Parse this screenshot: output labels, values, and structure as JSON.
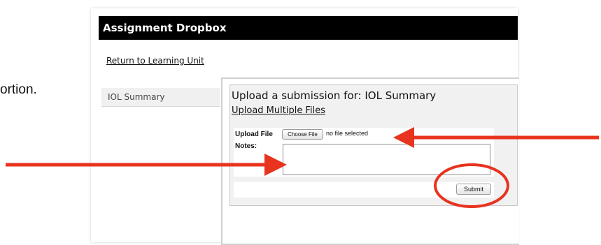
{
  "doc_text": "ortion.",
  "header": {
    "title": "Assignment Dropbox"
  },
  "nav": {
    "return_link": "Return to Learning Unit"
  },
  "sidebar": {
    "items": [
      {
        "label": "IOL Summary"
      }
    ]
  },
  "upload": {
    "title": "Upload a submission for: IOL Summary",
    "multi_link": "Upload Multiple Files",
    "file_label": "Upload File",
    "choose_label": "Choose File",
    "file_status": "no file selected",
    "notes_label": "Notes:",
    "notes_value": "",
    "submit_label": "Submit"
  },
  "annotations": {
    "color": "#e8331f"
  }
}
